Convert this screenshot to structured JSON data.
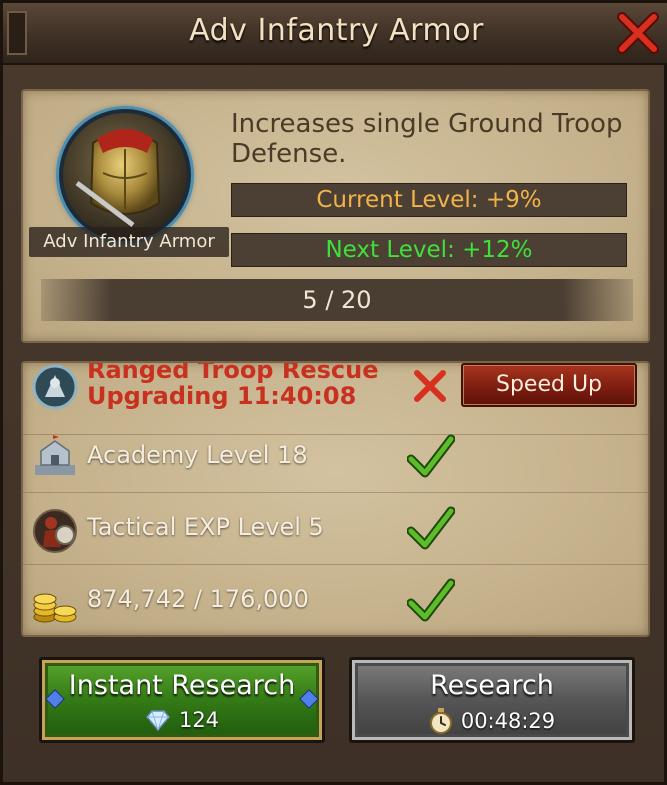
{
  "header": {
    "title": "Adv Infantry Armor"
  },
  "research": {
    "icon_label": "Adv Infantry Armor",
    "description": "Increases single Ground Troop Defense.",
    "current_level": "Current Level: +9%",
    "next_level": "Next Level: +12%",
    "progress_text": "5 / 20",
    "progress_fraction": 0.25
  },
  "requirements": {
    "blocked": {
      "title": "Ranged Troop Rescue",
      "timer": "Upgrading 11:40:08",
      "speed_up_label": "Speed Up"
    },
    "items": [
      {
        "label": "Academy Level 18",
        "icon": "academy-building-icon",
        "met": true
      },
      {
        "label": "Tactical EXP Level 5",
        "icon": "tactical-soldier-icon",
        "met": true
      },
      {
        "label": "874,742 / 176,000",
        "icon": "gold-coins-icon",
        "met": true
      }
    ]
  },
  "buttons": {
    "instant_label": "Instant Research",
    "instant_cost": "124",
    "research_label": "Research",
    "research_time": "00:48:29"
  },
  "colors": {
    "current_level": "#f2b44a",
    "next_level": "#3fe03c",
    "blocked_text": "#c8301f",
    "check": "#3c9a1a"
  }
}
